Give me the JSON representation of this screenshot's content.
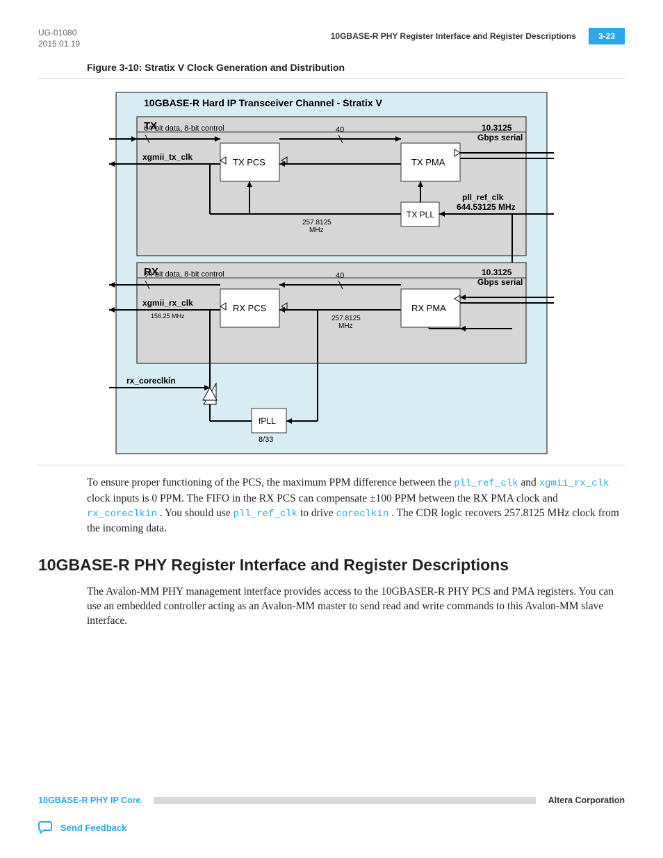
{
  "header": {
    "doc_id": "UG-01080",
    "date": "2015.01.19",
    "title_right": "10GBASE-R PHY Register Interface and Register Descriptions",
    "page_num": "3-23"
  },
  "figure": {
    "caption": "Figure 3-10: Stratix V Clock Generation and Distribution",
    "title": "10GBASE-R  Hard IP Transceiver Channel - Stratix V",
    "tx": {
      "label": "TX",
      "data_label": "64-bit data, 8-bit control",
      "clk_label": "xgmii_tx_clk",
      "pcs": "TX PCS",
      "pma": "TX PMA",
      "bus_width": "40",
      "serial_top": "10.3125",
      "serial_bot": "Gbps serial",
      "pll": "TX PLL",
      "pll_ref_top": "pll_ref_clk",
      "pll_ref_bot": "644.53125 MHz",
      "freq_top": "257.8125",
      "freq_bot": "MHz"
    },
    "rx": {
      "label": "RX",
      "data_label": "64-bit data, 8-bit control",
      "clk_label": "xgmii_rx_clk",
      "clk_freq": "156.25 MHz",
      "pcs": "RX PCS",
      "pma": "RX PMA",
      "bus_width": "40",
      "serial_top": "10.3125",
      "serial_bot": "Gbps serial",
      "freq_top": "257.8125",
      "freq_bot": "MHz"
    },
    "fpll": {
      "coreclk": "rx_coreclkin",
      "label": "fPLL",
      "ratio": "8/33"
    }
  },
  "paragraphs": {
    "p1a": "To ensure proper functioning of the PCS, the maximum PPM difference between the ",
    "p1b": " and ",
    "p1c": " clock inputs is 0 PPM. The FIFO in the RX PCS can compensate ±100 PPM between the RX PMA clock and ",
    "p1d": ". You should use ",
    "p1e": " to drive ",
    "p1f": ". The CDR logic recovers 257.8125 MHz clock from the incoming data.",
    "code1": "pll_ref_clk",
    "code2": "xgmii_rx_clk",
    "code3": "rx_coreclkin",
    "code4": "pll_ref_clk",
    "code5": "coreclkin"
  },
  "section": {
    "heading": "10GBASE-R PHY Register Interface and Register Descriptions",
    "body": "The Avalon-MM PHY management interface provides access to the 10GBASER-R PHY PCS and PMA registers. You can use an embedded controller acting as an Avalon-MM master to send read and write commands to this Avalon-MM slave interface."
  },
  "footer": {
    "left": "10GBASE-R PHY IP Core",
    "right": "Altera Corporation",
    "feedback": "Send Feedback"
  }
}
